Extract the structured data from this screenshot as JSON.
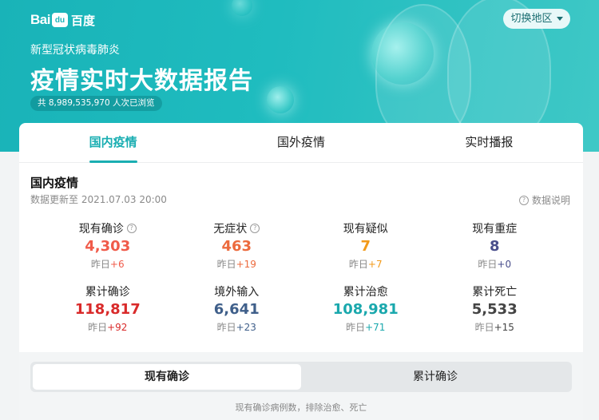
{
  "header": {
    "logo_latin": "Bai",
    "logo_paw": "du",
    "logo_cn": "百度",
    "subtitle": "新型冠状病毒肺炎",
    "title": "疫情实时大数据报告",
    "views": "共 8,989,535,970 人次已浏览",
    "region_button": "切换地区"
  },
  "tabs": [
    {
      "label": "国内疫情",
      "active": true
    },
    {
      "label": "国外疫情",
      "active": false
    },
    {
      "label": "实时播报",
      "active": false
    }
  ],
  "section": {
    "title": "国内疫情",
    "updated": "数据更新至 2021.07.03 20:00",
    "note": "数据说明"
  },
  "stats": [
    {
      "label": "现有确诊",
      "value": "4,303",
      "delta_prefix": "昨日",
      "delta": "+6",
      "color": "#f05b4a",
      "info": true
    },
    {
      "label": "无症状",
      "value": "463",
      "delta_prefix": "昨日",
      "delta": "+19",
      "color": "#ec6a3d",
      "info": true
    },
    {
      "label": "现有疑似",
      "value": "7",
      "delta_prefix": "昨日",
      "delta": "+7",
      "color": "#f29a1a",
      "info": false
    },
    {
      "label": "现有重症",
      "value": "8",
      "delta_prefix": "昨日",
      "delta": "+0",
      "color": "#4a4f8c",
      "info": false
    },
    {
      "label": "累计确诊",
      "value": "118,817",
      "delta_prefix": "昨日",
      "delta": "+92",
      "color": "#d92a2a",
      "info": false
    },
    {
      "label": "境外输入",
      "value": "6,641",
      "delta_prefix": "昨日",
      "delta": "+23",
      "color": "#3f5f8a",
      "info": false
    },
    {
      "label": "累计治愈",
      "value": "108,981",
      "delta_prefix": "昨日",
      "delta": "+71",
      "color": "#1aa8ad",
      "info": false
    },
    {
      "label": "累计死亡",
      "value": "5,533",
      "delta_prefix": "昨日",
      "delta": "+15",
      "color": "#444444",
      "info": false
    }
  ],
  "toggle": {
    "options": [
      "现有确诊",
      "累计确诊"
    ],
    "selected": 0,
    "footnote": "现有确诊病例数，排除治愈、死亡"
  }
}
